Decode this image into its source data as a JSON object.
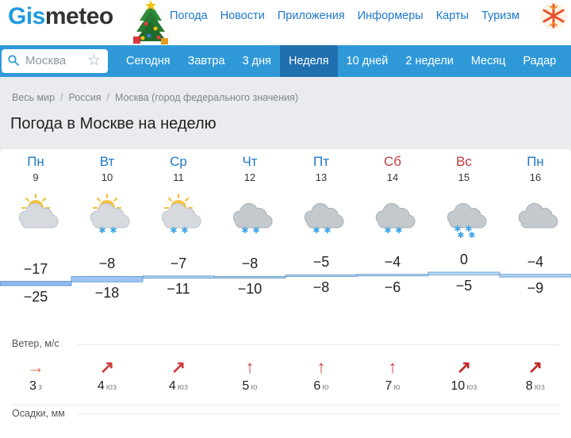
{
  "header": {
    "logo_part1": "Gis",
    "logo_part2": "meteo",
    "nav": [
      "Погода",
      "Новости",
      "Приложения",
      "Информеры",
      "Карты",
      "Туризм"
    ]
  },
  "search": {
    "value": "Москва"
  },
  "tabs": [
    "Сегодня",
    "Завтра",
    "3 дня",
    "Неделя",
    "10 дней",
    "2 недели",
    "Месяц",
    "Радар"
  ],
  "active_tab": "Неделя",
  "breadcrumb": [
    "Весь мир",
    "Россия",
    "Москва (город федерального значения)"
  ],
  "title": "Погода в Москве на неделю",
  "days": [
    {
      "name": "Пн",
      "num": "9",
      "weekend": false,
      "icon": "partly-cloudy",
      "max": "−17",
      "min": "−25",
      "wind": "3",
      "dir": "з",
      "arrow": "→",
      "arrow_color": "#e56a4b"
    },
    {
      "name": "Вт",
      "num": "10",
      "weekend": false,
      "icon": "partly-cloudy-snow",
      "max": "−8",
      "min": "−18",
      "wind": "4",
      "dir": "юз",
      "arrow": "↗",
      "arrow_color": "#d03c3c"
    },
    {
      "name": "Ср",
      "num": "11",
      "weekend": false,
      "icon": "partly-cloudy-snow",
      "max": "−7",
      "min": "−11",
      "wind": "4",
      "dir": "юз",
      "arrow": "↗",
      "arrow_color": "#d03c3c"
    },
    {
      "name": "Чт",
      "num": "12",
      "weekend": false,
      "icon": "cloudy-snow",
      "max": "−8",
      "min": "−10",
      "wind": "5",
      "dir": "ю",
      "arrow": "↑",
      "arrow_color": "#d03c3c"
    },
    {
      "name": "Пт",
      "num": "13",
      "weekend": false,
      "icon": "cloudy-snow",
      "max": "−5",
      "min": "−8",
      "wind": "6",
      "dir": "ю",
      "arrow": "↑",
      "arrow_color": "#d03c3c"
    },
    {
      "name": "Сб",
      "num": "14",
      "weekend": true,
      "icon": "cloudy-snow",
      "max": "−4",
      "min": "−6",
      "wind": "7",
      "dir": "ю",
      "arrow": "↑",
      "arrow_color": "#d03c3c"
    },
    {
      "name": "Вс",
      "num": "15",
      "weekend": true,
      "icon": "cloudy-heavy-snow",
      "max": "0",
      "min": "−5",
      "wind": "10",
      "dir": "юз",
      "arrow": "↗",
      "arrow_color": "#c02828"
    },
    {
      "name": "Пн",
      "num": "16",
      "weekend": false,
      "icon": "cloudy",
      "max": "−4",
      "min": "−9",
      "wind": "8",
      "dir": "юз",
      "arrow": "↗",
      "arrow_color": "#c02828"
    }
  ],
  "wind_label": "Ветер, м/с",
  "precip_label": "Осадки, мм",
  "colors": {
    "accent": "#2f99d8",
    "active_tab": "#206fae",
    "link": "#1e78c8",
    "weekend": "#c43b3b"
  }
}
